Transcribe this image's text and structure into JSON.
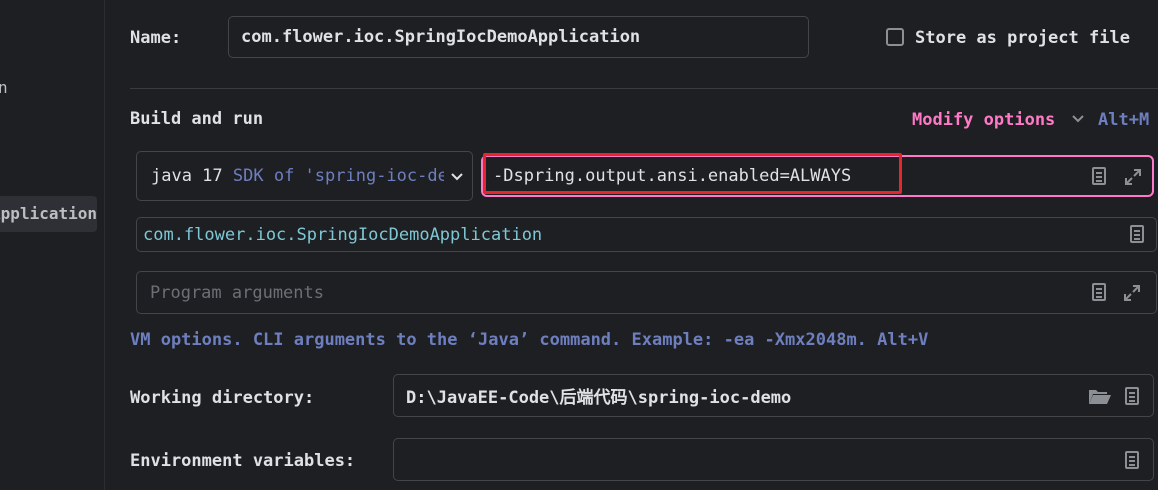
{
  "sidebar": {
    "fragment_top": "n",
    "selected_item": "SpringIocDemoApplication"
  },
  "name_row": {
    "label": "Name:",
    "value": "com.flower.ioc.SpringIocDemoApplication",
    "store_checkbox_label": "Store as project file",
    "store_checked": false
  },
  "build_run": {
    "title": "Build and run",
    "modify_options": "Modify options",
    "modify_shortcut": "Alt+M",
    "jdk_version": "java 17",
    "jdk_desc": "SDK of 'spring-ioc-demo' module",
    "vm_options_value": "-Dspring.output.ansi.enabled=ALWAYS",
    "main_class_value": "com.flower.ioc.SpringIocDemoApplication",
    "program_args_placeholder": "Program arguments",
    "hint": "VM options. CLI arguments to the ‘Java’ command. Example: -ea -Xmx2048m. Alt+V"
  },
  "working_dir": {
    "label": "Working directory:",
    "value": "D:\\JavaEE-Code\\后端代码\\spring-ioc-demo"
  },
  "env_vars": {
    "label": "Environment variables:",
    "value": ""
  },
  "colors": {
    "accent_pink": "#ff79c6",
    "highlight_red": "#e5262f",
    "main_class_cyan": "#7ec7d5",
    "hint_blue": "#6e7fc0"
  },
  "icons": [
    "doc-icon",
    "expand-icon",
    "chevron-down-icon",
    "folder-icon"
  ]
}
